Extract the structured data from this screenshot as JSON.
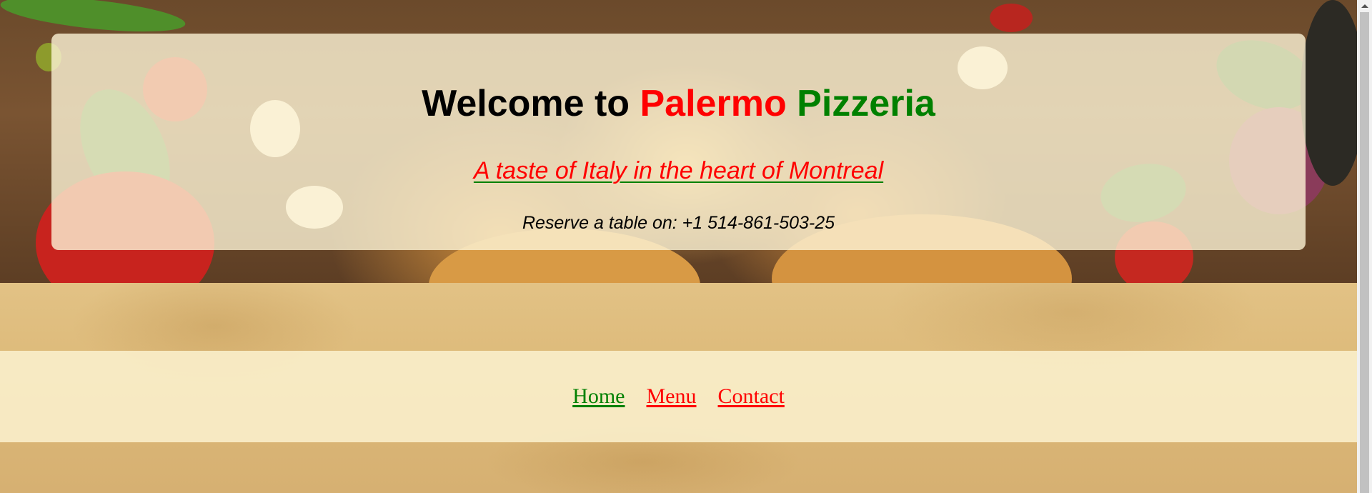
{
  "hero": {
    "title_prefix": "Welcome to ",
    "title_red": "Palermo",
    "title_space": " ",
    "title_green": "Pizzeria",
    "tagline": "A taste of Italy in the heart of Montreal",
    "reserve": "Reserve a table on: +1 514-861-503-25"
  },
  "nav": {
    "items": [
      {
        "label": "Home",
        "color": "#008000"
      },
      {
        "label": "Menu",
        "color": "#ff0000"
      },
      {
        "label": "Contact",
        "color": "#ff0000"
      }
    ]
  },
  "colors": {
    "accent_red": "#ff0000",
    "accent_green": "#008000"
  },
  "scrollbar": {
    "up_icon": "triangle-up-icon"
  }
}
